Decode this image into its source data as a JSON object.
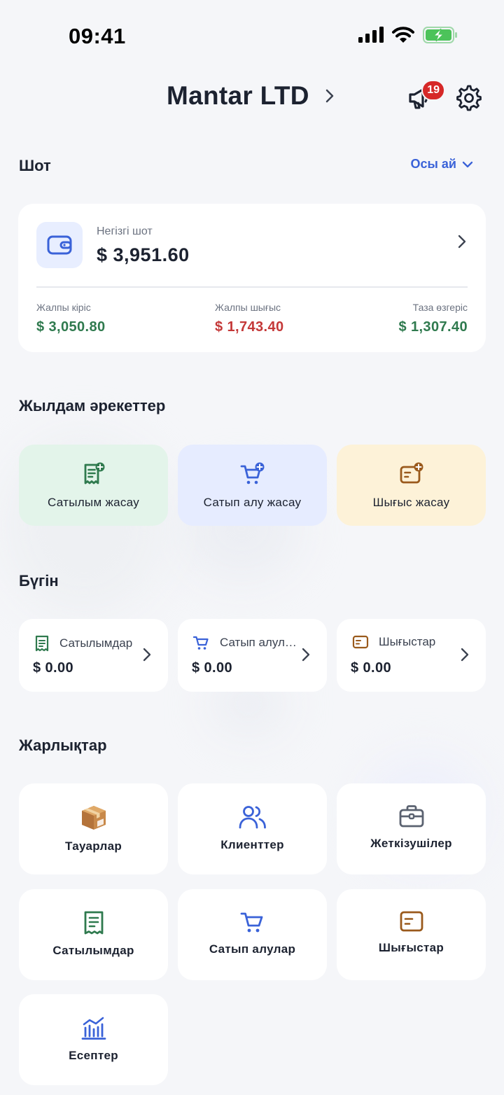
{
  "status_bar": {
    "time": "09:41"
  },
  "header": {
    "company_name": "Mantar LTD",
    "notifications_count": "19"
  },
  "account_section": {
    "title": "Шот",
    "period": "Осы ай"
  },
  "account_card": {
    "label": "Негізгі шот",
    "balance": "$ 3,951.60",
    "income_label": "Жалпы кіріс",
    "income_value": "$ 3,050.80",
    "expense_label": "Жалпы шығыс",
    "expense_value": "$ 1,743.40",
    "net_label": "Таза өзгеріс",
    "net_value": "$ 1,307.40"
  },
  "quick_actions": {
    "title": "Жылдам әрекеттер",
    "items": [
      {
        "label": "Сатылым жасау",
        "icon": "receipt-plus-icon",
        "bg": "#e3f4ea",
        "color": "#2f7a4e"
      },
      {
        "label": "Сатып алу жасау",
        "icon": "cart-plus-icon",
        "bg": "#e6ecff",
        "color": "#3a62d8"
      },
      {
        "label": "Шығыс жасау",
        "icon": "wallet-card-plus-icon",
        "bg": "#fdf2d8",
        "color": "#9a5a1c"
      }
    ]
  },
  "today": {
    "title": "Бүгін",
    "items": [
      {
        "label": "Сатылымдар",
        "amount": "$ 0.00"
      },
      {
        "label": "Сатып алулар",
        "amount": "$ 0.00"
      },
      {
        "label": "Шығыстар",
        "amount": "$ 0.00"
      }
    ]
  },
  "shortcuts": {
    "title": "Жарлықтар",
    "items": [
      {
        "label": "Тауарлар",
        "icon": "package-box-icon"
      },
      {
        "label": "Клиенттер",
        "icon": "users-icon"
      },
      {
        "label": "Жеткізушілер",
        "icon": "briefcase-icon"
      },
      {
        "label": "Сатылымдар",
        "icon": "receipt-icon"
      },
      {
        "label": "Сатып алулар",
        "icon": "cart-icon"
      },
      {
        "label": "Шығыстар",
        "icon": "card-icon"
      },
      {
        "label": "Есептер",
        "icon": "bar-chart-icon"
      }
    ]
  },
  "colors": {
    "accent_blue": "#3a62d8",
    "green": "#2f7a4e",
    "red": "#c43838",
    "brown": "#9a5a1c",
    "badge": "#d62828",
    "background": "#f5f6f9"
  }
}
